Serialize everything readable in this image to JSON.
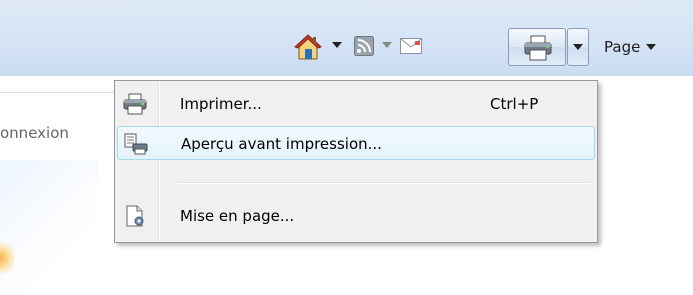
{
  "background_page": {
    "partial_text": "onnexion"
  },
  "toolbar": {
    "home": {
      "icon": "home-icon",
      "dropdown_icon": "chevron-down-icon"
    },
    "feeds": {
      "icon": "rss-feed-icon",
      "dropdown_icon": "chevron-down-icon"
    },
    "mail": {
      "icon": "mail-icon"
    },
    "print": {
      "icon": "printer-icon",
      "dropdown_icon": "chevron-down-icon",
      "state": "pressed"
    },
    "page": {
      "label": "Page",
      "dropdown_icon": "chevron-down-icon"
    }
  },
  "print_menu": {
    "items": [
      {
        "label": "Imprimer...",
        "shortcut": "Ctrl+P",
        "icon": "printer-icon",
        "highlighted": false
      },
      {
        "label": "Aperçu avant impression...",
        "shortcut": "",
        "icon": "print-preview-icon",
        "highlighted": true
      },
      {
        "label": "Mise en page...",
        "shortcut": "",
        "icon": "page-setup-icon",
        "highlighted": false
      }
    ]
  },
  "colors": {
    "toolbar_bg": "#d5e3f5",
    "menu_bg": "#f0f0f0",
    "menu_highlight_border": "#a8d8eb",
    "menu_highlight_bg": "#e3f3fb"
  }
}
